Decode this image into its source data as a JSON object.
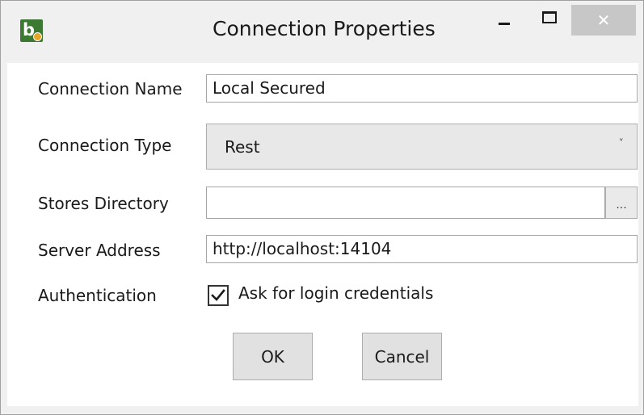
{
  "window": {
    "title": "Connection Properties",
    "close_glyph": "✕",
    "app_icon_letter": "b"
  },
  "form": {
    "connection_name": {
      "label": "Connection Name",
      "value": "Local Secured"
    },
    "connection_type": {
      "label": "Connection Type",
      "selected": "Rest",
      "chevron": "˅"
    },
    "stores_directory": {
      "label": "Stores Directory",
      "value": "",
      "browse_label": "..."
    },
    "server_address": {
      "label": "Server Address",
      "value": "http://localhost:14104"
    },
    "authentication": {
      "label": "Authentication",
      "checkbox_label": "Ask for login credentials",
      "checked": true
    }
  },
  "buttons": {
    "ok": "OK",
    "cancel": "Cancel"
  },
  "icons": {
    "app": "app-logo-icon",
    "minimize": "minimize-icon",
    "maximize": "maximize-icon",
    "close": "close-icon",
    "chevron": "chevron-down-icon",
    "check": "checkmark-icon"
  },
  "colors": {
    "window_bg": "#f0f0f0",
    "content_bg": "#ffffff",
    "close_button_bg": "#c7c7c7",
    "app_icon_green": "#3c7a33",
    "app_icon_orange": "#e8a62a"
  }
}
